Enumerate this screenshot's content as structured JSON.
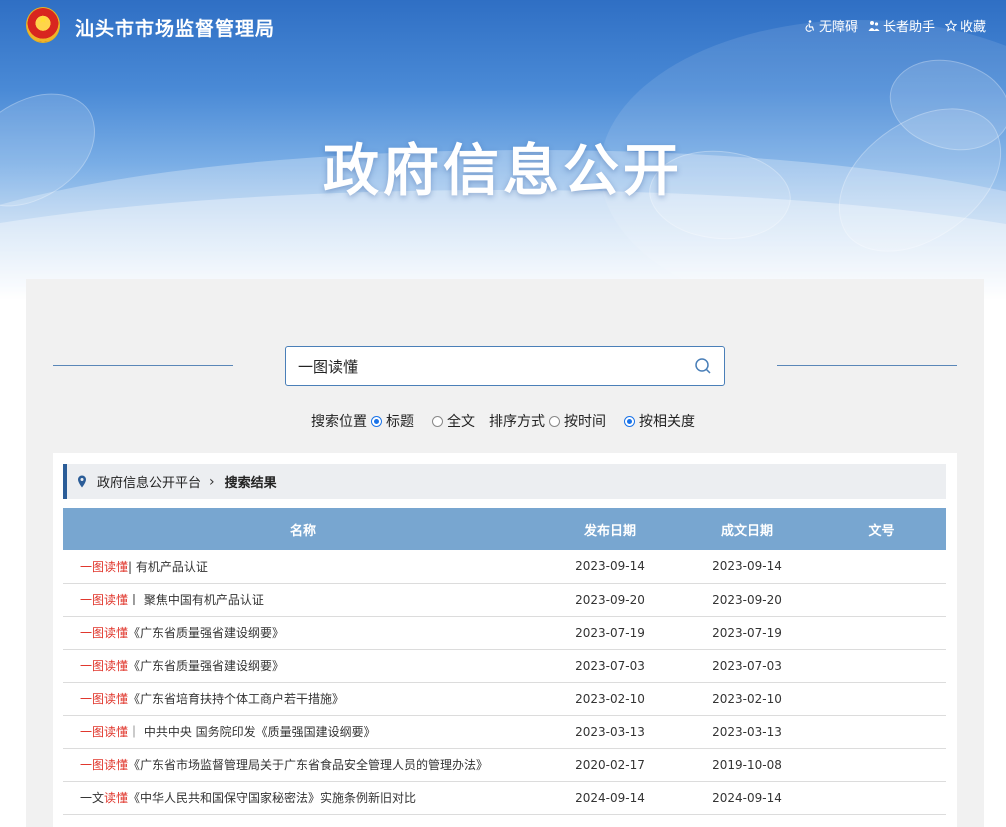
{
  "header": {
    "site_title": "汕头市市场监督管理局",
    "links": [
      {
        "label": "无障碍",
        "icon": "wheelchair-icon"
      },
      {
        "label": "长者助手",
        "icon": "elder-helper-icon"
      },
      {
        "label": "收藏",
        "icon": "star-icon"
      }
    ]
  },
  "hero": {
    "title": "政府信息公开"
  },
  "search": {
    "value": "一图读懂",
    "icon": "search-icon",
    "position_label": "搜索位置",
    "position_options": [
      {
        "label": "标题",
        "selected": true
      },
      {
        "label": "全文",
        "selected": false
      }
    ],
    "sort_label": "排序方式",
    "sort_options": [
      {
        "label": "按时间",
        "selected": false
      },
      {
        "label": "按相关度",
        "selected": true
      }
    ]
  },
  "breadcrumb": {
    "icon": "location-pin-icon",
    "root": "政府信息公开平台",
    "current": "搜索结果"
  },
  "table": {
    "headers": [
      "名称",
      "发布日期",
      "成文日期",
      "文号"
    ],
    "rows": [
      {
        "pre": "",
        "highlight": "一图读懂",
        "rest": "| 有机产品认证",
        "published": "2023-09-14",
        "written": "2023-09-14",
        "doc_no": ""
      },
      {
        "pre": "",
        "highlight": "一图读懂",
        "rest": "丨 聚焦中国有机产品认证",
        "published": "2023-09-20",
        "written": "2023-09-20",
        "doc_no": ""
      },
      {
        "pre": "",
        "highlight": "一图读懂",
        "rest": "《广东省质量强省建设纲要》",
        "published": "2023-07-19",
        "written": "2023-07-19",
        "doc_no": ""
      },
      {
        "pre": "",
        "highlight": "一图读懂",
        "rest": "《广东省质量强省建设纲要》",
        "published": "2023-07-03",
        "written": "2023-07-03",
        "doc_no": ""
      },
      {
        "pre": "",
        "highlight": "一图读懂",
        "rest": "《广东省培育扶持个体工商户若干措施》",
        "published": "2023-02-10",
        "written": "2023-02-10",
        "doc_no": ""
      },
      {
        "pre": "",
        "highlight": "一图读懂",
        "rest": "｜ 中共中央  国务院印发《质量强国建设纲要》",
        "published": "2023-03-13",
        "written": "2023-03-13",
        "doc_no": ""
      },
      {
        "pre": "",
        "highlight": "一图读懂",
        "rest": "《广东省市场监督管理局关于广东省食品安全管理人员的管理办法》",
        "published": "2020-02-17",
        "written": "2019-10-08",
        "doc_no": ""
      },
      {
        "pre": "一文",
        "highlight": "读懂",
        "rest": "《中华人民共和国保守国家秘密法》实施条例新旧对比",
        "published": "2024-09-14",
        "written": "2024-09-14",
        "doc_no": ""
      }
    ]
  }
}
